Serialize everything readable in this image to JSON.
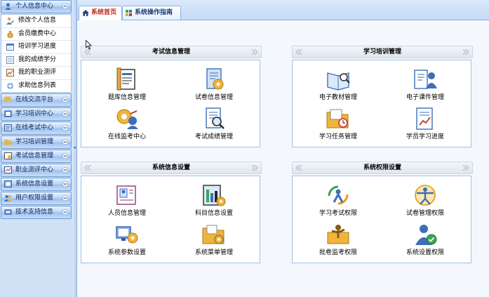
{
  "sidebar": {
    "groups": [
      {
        "label": "个人信息中心",
        "icon": "user-icon",
        "items": [
          {
            "label": "修改个人信息",
            "icon": "edit-user-icon"
          },
          {
            "label": "会员缴费中心",
            "icon": "money-bag-icon"
          },
          {
            "label": "培训学习进度",
            "icon": "calendar-icon"
          },
          {
            "label": "我的成绩学分",
            "icon": "grade-icon"
          },
          {
            "label": "我的职业测评",
            "icon": "chart-icon"
          },
          {
            "label": "求助信息列表",
            "icon": "help-list-icon"
          }
        ]
      },
      {
        "label": "在线交流平台",
        "icon": "chat-icon"
      },
      {
        "label": "学习培训中心",
        "icon": "book-icon"
      },
      {
        "label": "在线考试中心",
        "icon": "exam-icon"
      },
      {
        "label": "学习培训管理",
        "icon": "study-manage-icon"
      },
      {
        "label": "考试信息管理",
        "icon": "exam-manage-icon"
      },
      {
        "label": "职业测评中心",
        "icon": "assessment-icon"
      },
      {
        "label": "系统信息设置",
        "icon": "settings-icon"
      },
      {
        "label": "用户权限设置",
        "icon": "users-icon"
      },
      {
        "label": "技术支持信息",
        "icon": "support-icon"
      }
    ]
  },
  "tabs": [
    {
      "label": "系统首页",
      "icon": "home-icon"
    },
    {
      "label": "系统操作指南",
      "icon": "guide-icon"
    }
  ],
  "panels": [
    {
      "title": "考试信息管理",
      "items": [
        {
          "label": "题库信息管理",
          "icon": "question-bank-icon"
        },
        {
          "label": "试卷信息管理",
          "icon": "exam-paper-icon"
        },
        {
          "label": "在线监考中心",
          "icon": "proctor-icon"
        },
        {
          "label": "考试成绩管理",
          "icon": "score-icon"
        }
      ]
    },
    {
      "title": "学习培训管理",
      "items": [
        {
          "label": "电子教材管理",
          "icon": "e-textbook-icon"
        },
        {
          "label": "电子课件管理",
          "icon": "e-courseware-icon"
        },
        {
          "label": "学习任务管理",
          "icon": "task-folder-icon"
        },
        {
          "label": "学员学习进度",
          "icon": "progress-doc-icon"
        }
      ]
    },
    {
      "title": "系统信息设置",
      "items": [
        {
          "label": "人员信息管理",
          "icon": "person-card-icon"
        },
        {
          "label": "科目信息设置",
          "icon": "subject-icon"
        },
        {
          "label": "系统参数设置",
          "icon": "params-icon"
        },
        {
          "label": "系统菜单管理",
          "icon": "menu-folder-icon"
        }
      ]
    },
    {
      "title": "系统权限设置",
      "items": [
        {
          "label": "学习考试权限",
          "icon": "recycle-person-icon"
        },
        {
          "label": "试卷管理权限",
          "icon": "vitruvian-icon"
        },
        {
          "label": "批卷监考权限",
          "icon": "grader-icon"
        },
        {
          "label": "系统设置权限",
          "icon": "system-permission-icon"
        }
      ]
    }
  ],
  "colors": {
    "accent": "#c4261d",
    "nav_text": "#0b2a63",
    "panel_border": "#9fc2ea"
  }
}
